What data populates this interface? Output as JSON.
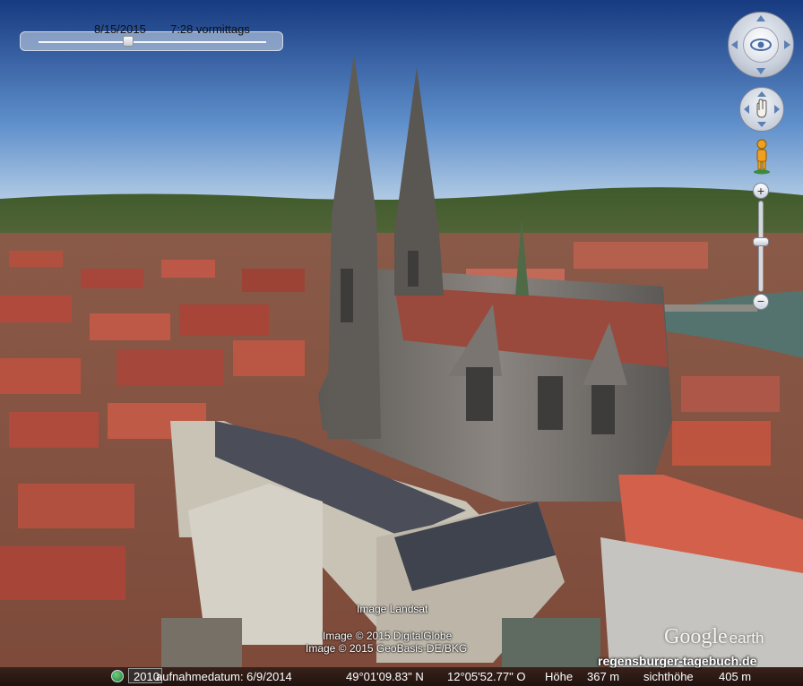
{
  "time_slider": {
    "date": "8/15/2015",
    "time": "7:28 vormittags",
    "position": 0.39
  },
  "navigation": {
    "look_icon": "eye-icon",
    "move_icon": "hand-icon",
    "street_view_icon": "pegman-icon",
    "zoom_in": "+",
    "zoom_out": "−",
    "zoom_level": 0.45
  },
  "attribution": {
    "line1": "Image Landsat",
    "line2": "Image © 2015 DigitalGlobe",
    "line3": "Image © 2015 GeoBasis-DE/BKG"
  },
  "logo": {
    "google": "Google",
    "earth": "earth"
  },
  "watermark": "regensburger-tagebuch.de",
  "status_bar": {
    "stream_percent": "2010",
    "capture_date": "aufnahmedatum: 6/9/2014",
    "latitude": "49°01'09.83\" N",
    "longitude": "12°05'52.77\" O",
    "elevation_label": "Höhe",
    "elevation": "367 m",
    "eye_alt_label": "sichthöhe",
    "eye_alt": "405 m"
  },
  "colors": {
    "sky_top": "#1b3f86",
    "sky_horizon": "#9fc0df",
    "roof": "#b6473a",
    "stone": "#6e6a66"
  }
}
